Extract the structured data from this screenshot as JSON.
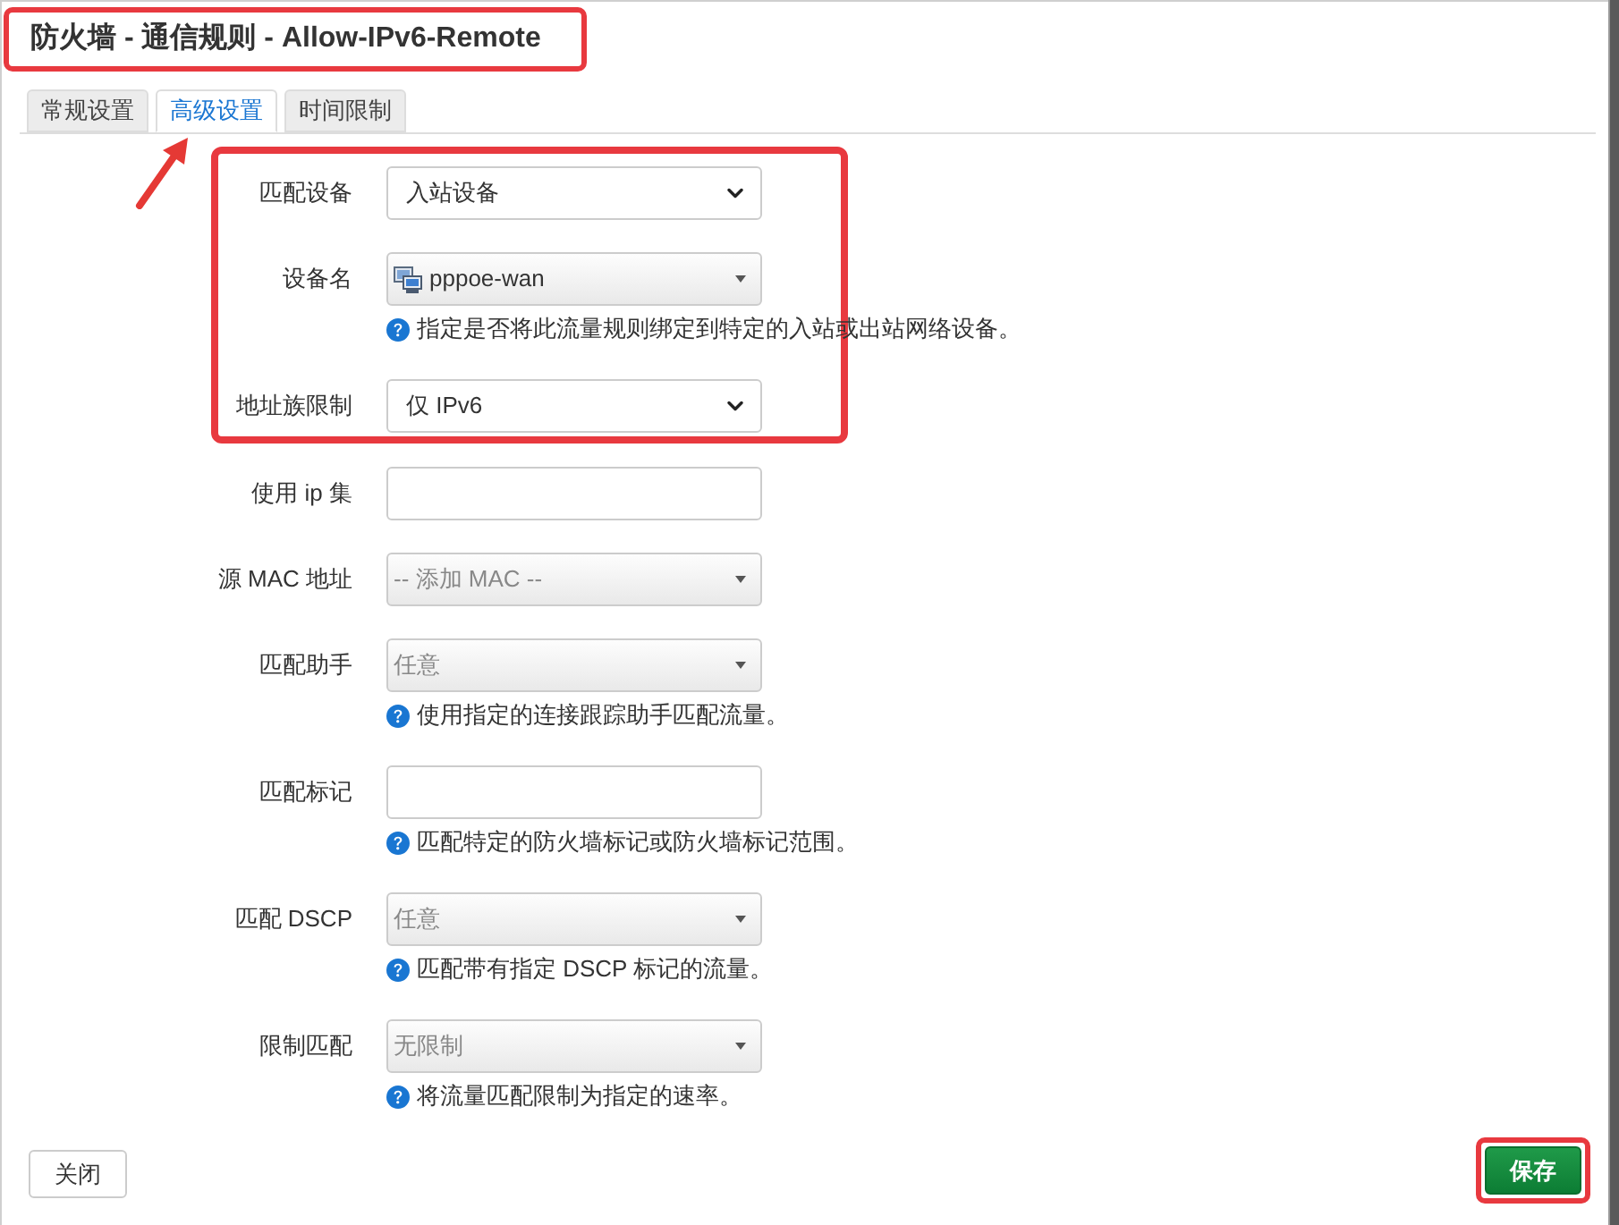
{
  "dialog": {
    "title": "防火墙 - 通信规则 - Allow-IPv6-Remote",
    "highlighted": true
  },
  "tabs": [
    {
      "label": "常规设置",
      "selected": false,
      "highlighted": false
    },
    {
      "label": "高级设置",
      "selected": true,
      "highlighted": true
    },
    {
      "label": "时间限制",
      "selected": false,
      "highlighted": false
    }
  ],
  "fields": [
    {
      "label": "匹配设备",
      "kind": "select",
      "value": "入站设备",
      "highlighted": true
    },
    {
      "label": "设备名",
      "kind": "device-dropdown",
      "value": "pppoe-wan",
      "help": "指定是否将此流量规则绑定到特定的入站或出站网络设备。",
      "highlighted": true
    },
    {
      "label": "地址族限制",
      "kind": "select",
      "value": "仅 IPv6",
      "highlighted": true
    },
    {
      "label": "使用 ip 集",
      "kind": "text",
      "highlighted": false
    },
    {
      "label": "源 MAC 地址",
      "kind": "dropdown",
      "placeholder": "-- 添加 MAC --",
      "highlighted": false
    },
    {
      "label": "匹配助手",
      "kind": "dropdown",
      "placeholder": "任意",
      "help": "使用指定的连接跟踪助手匹配流量。",
      "highlighted": false
    },
    {
      "label": "匹配标记",
      "kind": "text",
      "help": "匹配特定的防火墙标记或防火墙标记范围。",
      "highlighted": false
    },
    {
      "label": "匹配 DSCP",
      "kind": "dropdown",
      "placeholder": "任意",
      "help": "匹配带有指定 DSCP 标记的流量。",
      "highlighted": false
    },
    {
      "label": "限制匹配",
      "kind": "dropdown",
      "placeholder": "无限制",
      "help": "将流量匹配限制为指定的速率。",
      "highlighted": false
    }
  ],
  "buttons": [
    {
      "label": "关闭",
      "kind": "default",
      "highlighted": false
    },
    {
      "label": "保存",
      "kind": "primary",
      "highlighted": true
    }
  ]
}
